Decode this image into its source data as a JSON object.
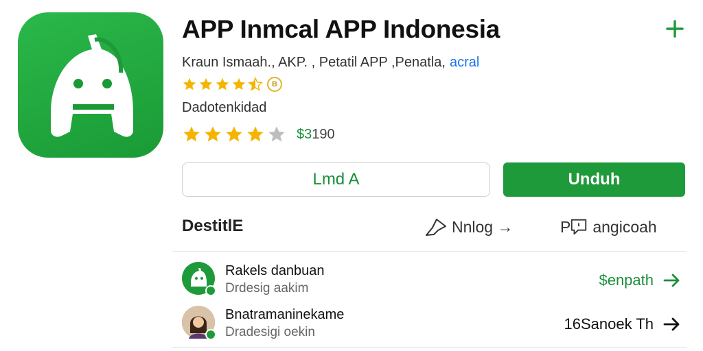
{
  "app": {
    "title": "APP Inmcal APP Indonesia",
    "developer": "Kraun Ismaah., AKP. , Petatil APP ,Penatla,",
    "developer_link": "acral",
    "rating_badge": "B",
    "rating_stars": 4.5,
    "category": "Dadotenkidad",
    "rating_stars_secondary": 4,
    "price_prefix": "$3",
    "price_rest": "190"
  },
  "actions": {
    "secondary_label": "Lmd A",
    "primary_label": "Unduh"
  },
  "section": {
    "title": "DestitlE",
    "action_one": "Nnlog →",
    "action_two_prefix": "P",
    "action_two": "angicoah"
  },
  "list": [
    {
      "name": "Rakels danbuan",
      "sub": "Drdesig aakim",
      "right": "$enpath",
      "right_color": "#1a8f3a"
    },
    {
      "name": "Bnatramaninekame",
      "sub": "Dradesigi oekin",
      "right": "16Sanoek Th",
      "right_color": "#111111"
    }
  ],
  "colors": {
    "brand_green": "#1e9a3a",
    "star_gold": "#f5b400",
    "star_grey": "#bdbdbd",
    "link_blue": "#1a73e8"
  },
  "icons": [
    "plus-icon",
    "star-icon",
    "share-icon",
    "review-icon",
    "arrow-right-icon"
  ]
}
